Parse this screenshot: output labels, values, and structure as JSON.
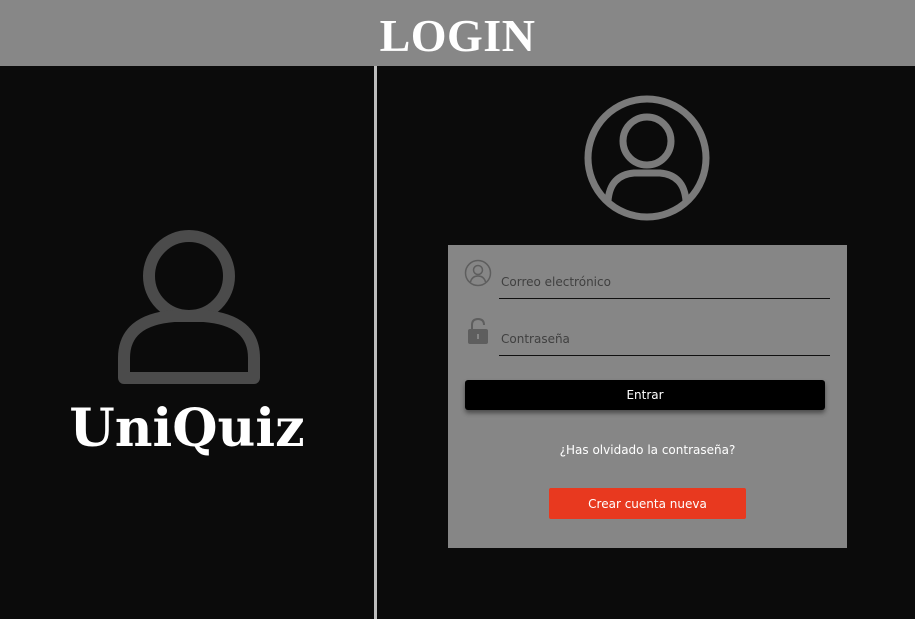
{
  "header": {
    "title": "LOGIN"
  },
  "brand": {
    "name": "UniQuiz",
    "icon": "user-icon"
  },
  "login": {
    "avatar_icon": "user-circle-icon",
    "email": {
      "icon": "user-circle-icon",
      "placeholder": "Correo electrónico",
      "value": ""
    },
    "password": {
      "icon": "lock-icon",
      "placeholder": "Contraseña",
      "value": ""
    },
    "submit_label": "Entrar",
    "forgot_label": "¿Has olvidado la contraseña?",
    "create_label": "Crear cuenta nueva"
  },
  "colors": {
    "header_bg": "#878787",
    "page_bg": "#0b0b0b",
    "card_bg": "#868686",
    "submit_bg": "#000000",
    "create_bg": "#e8391f",
    "divider": "#bdbdbd"
  }
}
